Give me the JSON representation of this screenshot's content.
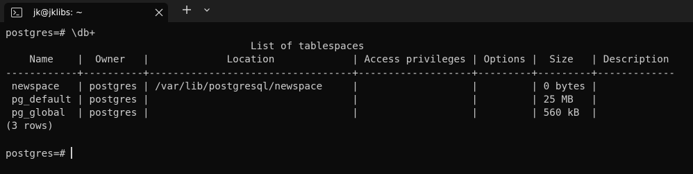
{
  "tab": {
    "icon": "terminal-icon",
    "title": "jk@jklibs: ~",
    "close_icon": "close-icon"
  },
  "tabbar": {
    "new_tab_icon": "plus-icon",
    "dropdown_icon": "chevron-down-icon"
  },
  "terminal": {
    "command_line": "postgres=# \\db+",
    "table_title": "                                         List of tablespaces",
    "header_row": "    Name    |  Owner   |             Location             | Access privileges | Options |  Size   | Description",
    "separator_row": "------------+----------+----------------------------------+-------------------+---------+---------+-------------",
    "rows": [
      " newspace   | postgres | /var/lib/postgresql/newspace     |                   |         | 0 bytes |",
      " pg_default | postgres |                                  |                   |         | 25 MB   |",
      " pg_global  | postgres |                                  |                   |         | 560 kB  |"
    ],
    "row_count": "(3 rows)",
    "blank_line": "",
    "prompt": "postgres=#"
  },
  "colors": {
    "background": "#0c0c0c",
    "tabbar": "#1f1f1f",
    "text": "#cccccc"
  }
}
